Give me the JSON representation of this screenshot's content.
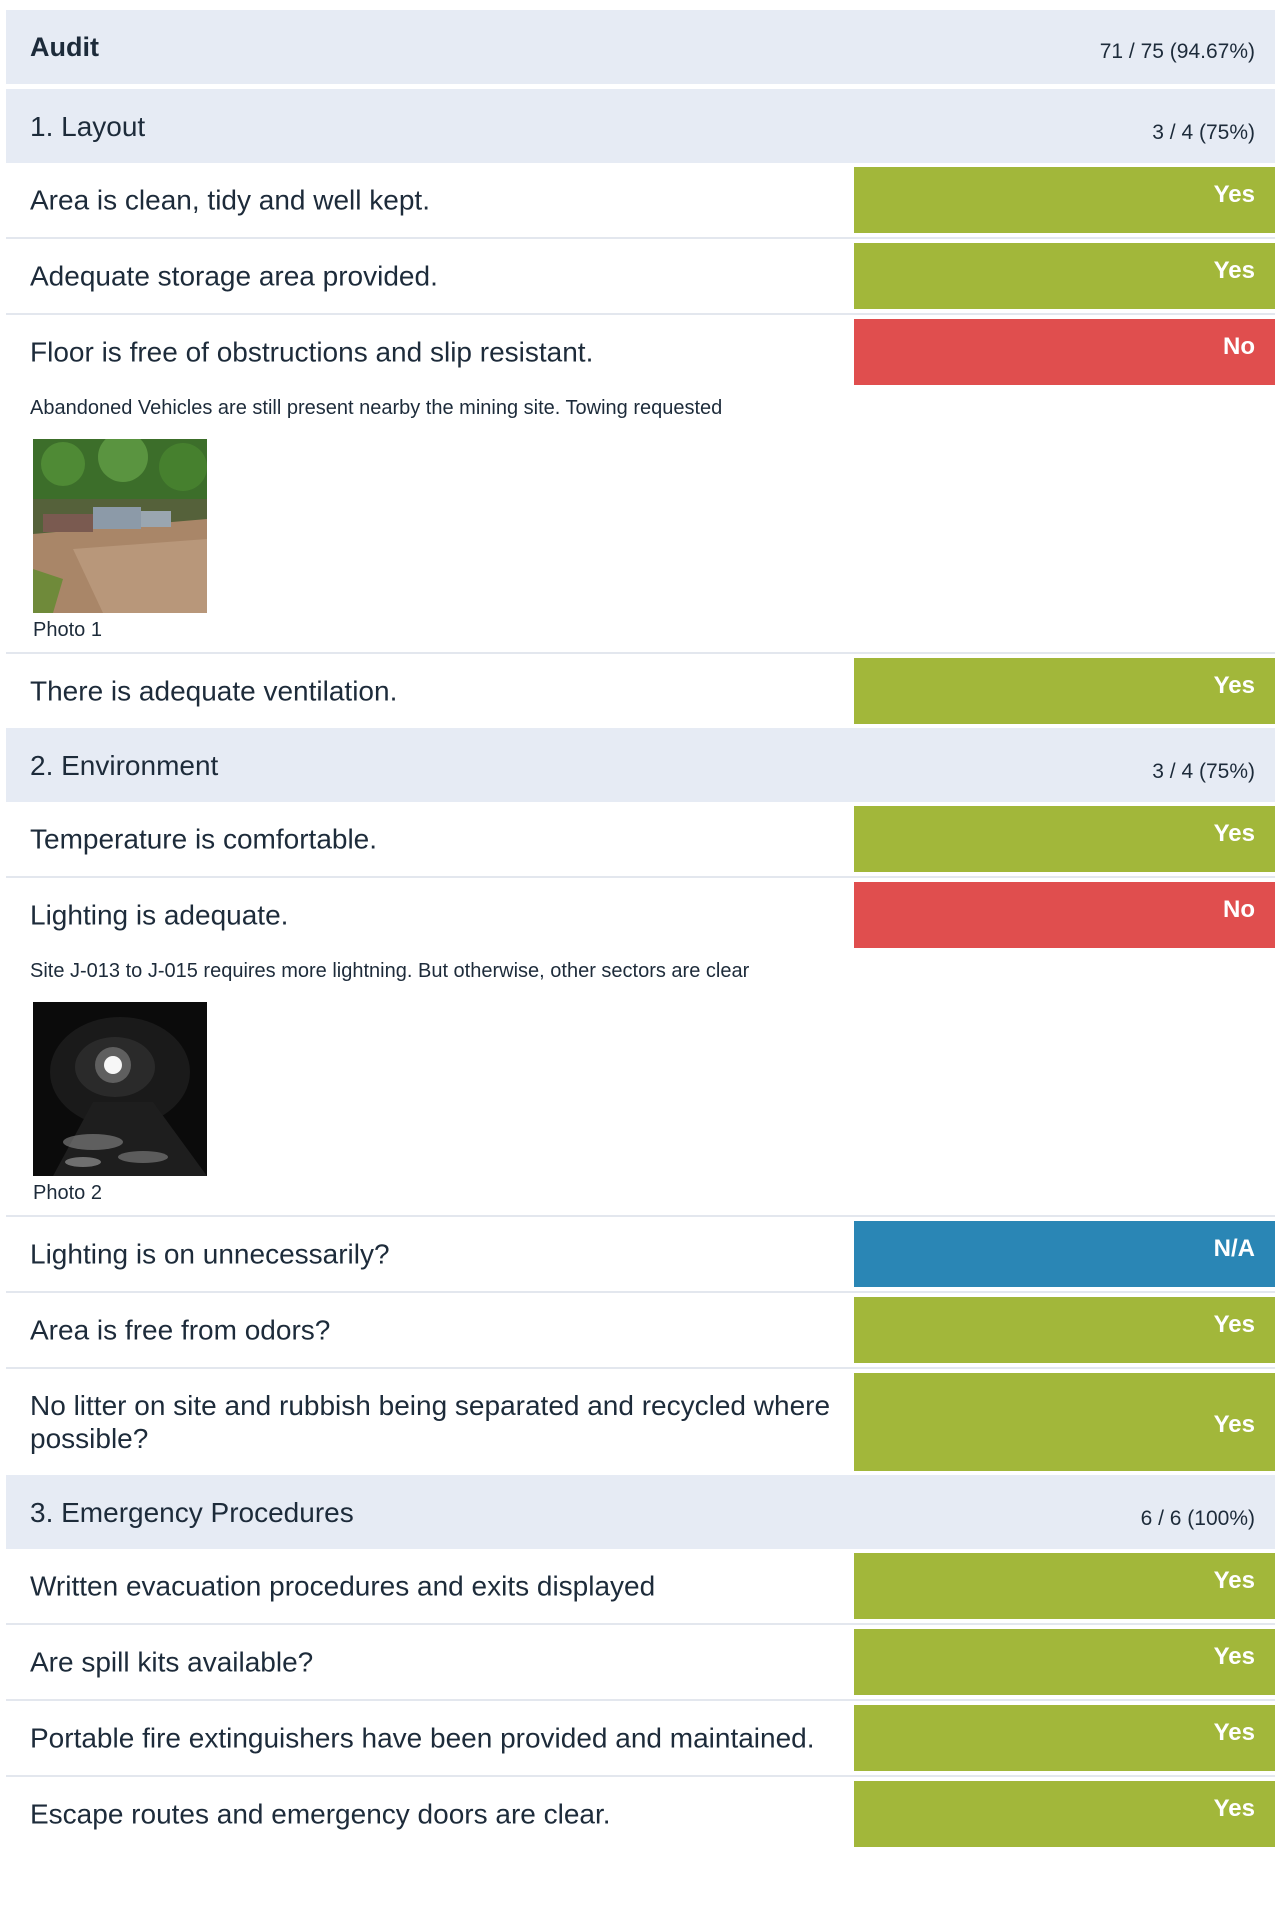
{
  "audit": {
    "title": "Audit",
    "score": "71 / 75 (94.67%)"
  },
  "sections": [
    {
      "title": "1. Layout",
      "score": "3 / 4 (75%)",
      "items": [
        {
          "question": "Area is clean, tidy and well kept.",
          "answer": "Yes"
        },
        {
          "question": "Adequate storage area provided.",
          "answer": "Yes"
        },
        {
          "question": "Floor is free of obstructions and slip resistant.",
          "answer": "No",
          "note": "Abandoned Vehicles are still present nearby the mining site. Towing requested",
          "photo_caption": "Photo 1"
        },
        {
          "question": "There is adequate ventilation.",
          "answer": "Yes"
        }
      ]
    },
    {
      "title": "2. Environment",
      "score": "3 / 4 (75%)",
      "items": [
        {
          "question": "Temperature is comfortable.",
          "answer": "Yes"
        },
        {
          "question": "Lighting is adequate.",
          "answer": "No",
          "note": "Site J-013 to J-015 requires more lightning. But otherwise, other sectors are clear",
          "photo_caption": "Photo 2"
        },
        {
          "question": "Lighting is on unnecessarily?",
          "answer": "N/A"
        },
        {
          "question": "Area is free from odors?",
          "answer": "Yes"
        },
        {
          "question": "No litter on site and rubbish being separated and recycled where possible?",
          "answer": "Yes"
        }
      ]
    },
    {
      "title": "3. Emergency Procedures",
      "score": "6 / 6 (100%)",
      "items": [
        {
          "question": "Written evacuation procedures and exits displayed",
          "answer": "Yes"
        },
        {
          "question": "Are spill kits available?",
          "answer": "Yes"
        },
        {
          "question": "Portable fire extinguishers have been provided and maintained.",
          "answer": "Yes"
        },
        {
          "question": "Escape routes and emergency doors are clear.",
          "answer": "Yes"
        }
      ]
    }
  ],
  "colors": {
    "yes": "#a2b73a",
    "no": "#e04e4e",
    "na": "#2a86b5",
    "header_bg": "#e6ebf4"
  }
}
